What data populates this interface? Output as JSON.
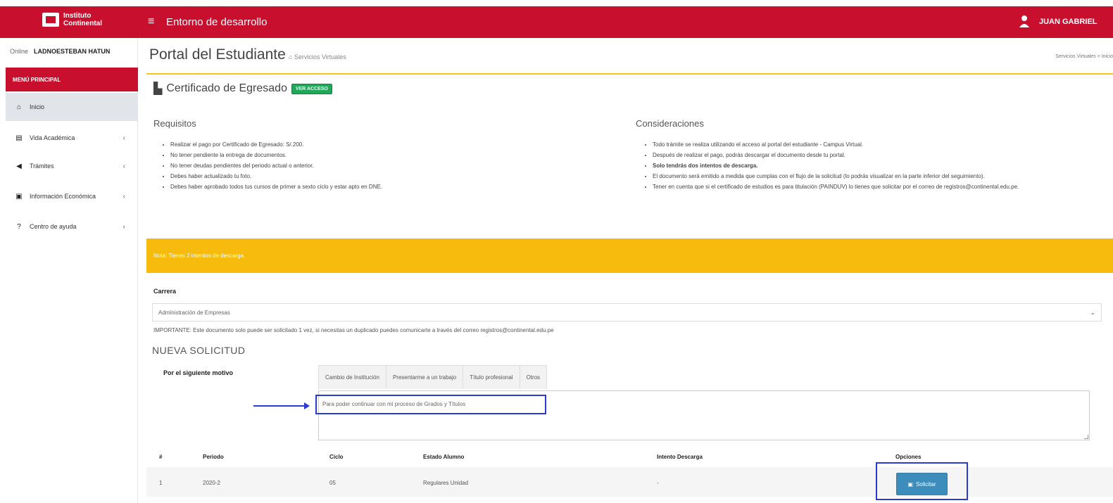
{
  "topbar": {
    "logo_line1": "Instituto",
    "logo_line2": "Continental",
    "title": "Entorno de desarrollo",
    "user_name": "JUAN GABRIEL",
    "menu_icon": "hamburger-icon",
    "user_icon": "user-icon",
    "bg_color": "#c8102e"
  },
  "sidebar": {
    "user_status": "Online",
    "user_name": "LADNOESTEBAN HATUN",
    "menu_header": "MENÚ PRINCIPAL",
    "items": [
      {
        "label": "Inicio",
        "icon": "home-icon",
        "active": true
      },
      {
        "label": "Vida Académica",
        "icon": "book-icon",
        "active": false
      },
      {
        "label": "Trámites",
        "icon": "megaphone-icon",
        "active": false
      },
      {
        "label": "Información Económica",
        "icon": "document-icon",
        "active": false
      },
      {
        "label": "Centro de ayuda",
        "icon": "help-icon",
        "active": false
      }
    ]
  },
  "header": {
    "title": "Portal del Estudiante",
    "subtitle": "Servicios Virtuales",
    "breadcrumb": "Servicios Virtuales > Inicio"
  },
  "certificate": {
    "title": "Certificado de Egresado",
    "badge": "VER ACCESO"
  },
  "requirements": {
    "title": "Requisitos",
    "items": [
      "Realizar el pago por Certificado de Egresado: S/.200.",
      "No tener pendiente la entrega de documentos.",
      "No tener deudas pendientes del periodo actual o anterior.",
      "Debes haber actualizado tu foto.",
      "Debes haber aprobado todos tus cursos de primer a sexto ciclo y estar apto en DNE."
    ]
  },
  "considerations": {
    "title": "Consideraciones",
    "items": [
      {
        "text": "Todo trámite se realiza utilizando el acceso al portal del estudiante - Campus Virtual.",
        "bold": false
      },
      {
        "text": "Después de realizar el pago, podrás descargar el documento desde tu portal.",
        "bold": false
      },
      {
        "text": "Solo tendrás dos intentos de descarga.",
        "bold": true
      },
      {
        "text": "El documento será emitido a medida que cumplas con el flujo de la solicitud (lo podrás visualizar en la parte inferior del seguimiento).",
        "bold": false
      },
      {
        "text": "Tener en cuenta que si el certificado de estudios es para titulación (PAINDUV) lo tienes que solicitar por el correo de registros@continental.edu.pe.",
        "bold": false
      }
    ]
  },
  "alert": {
    "text": "Nota: Tienes 2 intentos de descarga.",
    "color": "#f6bb0c"
  },
  "form": {
    "carrera_label": "Carrera",
    "carrera_value": "Administración de Empresas",
    "important": "IMPORTANTE: Este documento solo puede ser solicitado 1 vez, si necesitas un duplicado puedes comunicarte a través del correo registros@continental.edu.pe",
    "section_title": "NUEVA SOLICITUD",
    "motivo_label": "Por el siguiente motivo",
    "tabs": [
      "Cambio de Institución",
      "Presentarme a un trabajo",
      "Título profesional",
      "Otros"
    ],
    "motivo_value": "Para poder continuar con mi proceso de Grados y Títulos"
  },
  "table": {
    "headers": [
      "#",
      "Periodo",
      "Ciclo",
      "Estado Alumno",
      "Intento Descarga",
      "Opciones"
    ],
    "rows": [
      {
        "num": "1",
        "periodo": "2020-2",
        "ciclo": "05",
        "estado": "Regulares Unidad",
        "intento": "-"
      }
    ],
    "action_label": "Solicitar",
    "action_icon": "save-icon",
    "action_color": "#3c8dbc"
  },
  "annotations": {
    "color": "#2a3bd4"
  }
}
